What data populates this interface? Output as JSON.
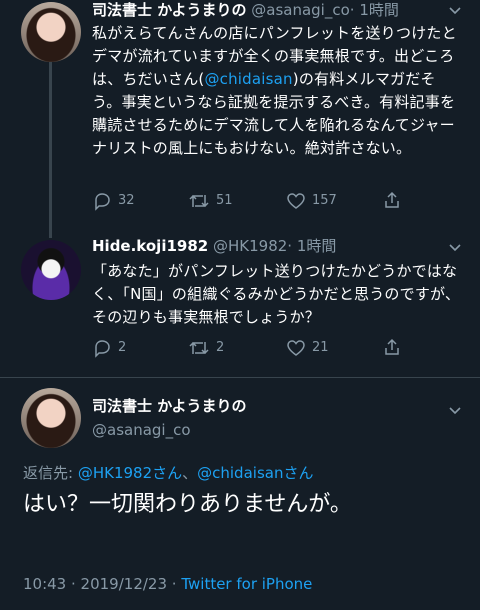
{
  "tweet1": {
    "display_name": "司法書士 かようまりの",
    "handle": "@asanagi_co",
    "time": "· 1時間",
    "text_before": "私がえらてんさんの店にパンフレットを送りつけたとデマが流れていますが全くの事実無根です。出どころは、ちだいさん(",
    "mention": "@chidaisan",
    "text_after": ")の有料メルマガだそう。事実というなら証拠を提示するべき。有料記事を購読させるためにデマ流して人を陥れるなんてジャーナリストの風上にもおけない。絶対許さない。",
    "replies": "32",
    "retweets": "51",
    "likes": "157"
  },
  "tweet2": {
    "display_name": "Hide.koji1982",
    "handle": "@HK1982",
    "time": "· 1時間",
    "text": "「あなた」がパンフレット送りつけたかどうかではなく、「N国」の組織ぐるみかどうかだと思うのですが、その辺りも事実無根でしょうか？",
    "replies": "2",
    "retweets": "2",
    "likes": "21"
  },
  "tweet3": {
    "display_name": "司法書士 かようまりの",
    "handle": "@asanagi_co",
    "replying_label": "返信先: ",
    "replying_to_1": "@HK1982さん",
    "replying_sep": "、",
    "replying_to_2": "@chidaisanさん",
    "text": "はい？一切関わりありませんが。",
    "time": "10:43",
    "date": "· 2019/12/23 ·",
    "client": "Twitter for iPhone"
  },
  "colors": {
    "background": "#141d26",
    "secondary_text": "#8899a6",
    "link": "#1da1f2"
  }
}
